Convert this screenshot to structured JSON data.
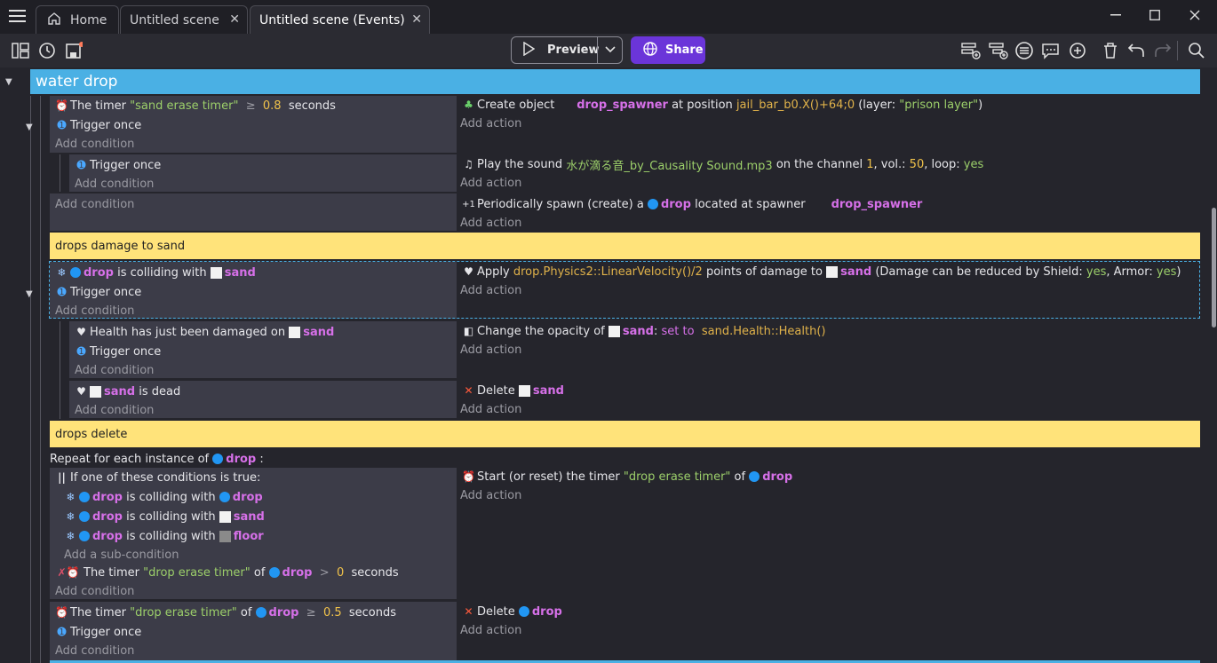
{
  "tabs": {
    "home": "Home",
    "scene": "Untitled scene",
    "events": "Untitled scene (Events)"
  },
  "toolbar": {
    "preview": "Preview",
    "share": "Share"
  },
  "group": {
    "title": "water drop"
  },
  "comments": [
    "drops damage to sand",
    "drops delete"
  ],
  "e1": {
    "c1": {
      "pre": "The timer",
      "str": "\"sand erase timer\"",
      "op": "≥",
      "num": "0.8",
      "post": "seconds"
    },
    "c2": "Trigger once",
    "a1": {
      "pre": "Create object",
      "obj": "drop_spawner",
      "mid": "at position",
      "expr": "jail_bar_b0.X()+64;0",
      "layer_pre": "(layer:",
      "layer": "\"prison layer\"",
      "layer_post": ")"
    }
  },
  "e1s": {
    "c1": "Trigger once",
    "a1": {
      "pre": "Play the sound",
      "file": "水が滴る音_by_Causality Sound.mp3",
      "mid": "on the channel",
      "chan": "1",
      "vol_pre": ", vol.:",
      "vol": "50",
      "loop_pre": ", loop:",
      "loop": "yes"
    }
  },
  "e2": {
    "a1": {
      "pre": "Periodically spawn (create) a",
      "obj": "drop",
      "mid": "located at spawner",
      "spawner": "drop_spawner"
    }
  },
  "e3": {
    "c1": {
      "obj": "drop",
      "mid": "is colliding with",
      "obj2": "sand"
    },
    "c2": "Trigger once",
    "a1": {
      "pre": "Apply",
      "expr": "drop.Physics2::LinearVelocity()/2",
      "mid": "points of damage to",
      "obj": "sand",
      "tail1": "(Damage can be reduced by Shield:",
      "shield": "yes",
      "tail2": ", Armor:",
      "armor": "yes",
      "tail3": ")"
    }
  },
  "e3s1": {
    "c1": {
      "pre": "Health has just been damaged on",
      "obj": "sand"
    },
    "c2": "Trigger once",
    "a1": {
      "pre": "Change the opacity of",
      "obj": "sand",
      "colon": ":",
      "op": "set to",
      "expr": "sand.Health::Health()"
    }
  },
  "e3s2": {
    "c1": {
      "obj": "sand",
      "post": "is dead"
    },
    "a1": {
      "pre": "Delete",
      "obj": "sand"
    }
  },
  "e4": {
    "repeat": {
      "pre": "Repeat for each instance of",
      "obj": "drop",
      "post": ":"
    },
    "or": "If one of these conditions is true:",
    "subs": [
      {
        "obj": "drop",
        "mid": "is colliding with",
        "obj2": "drop"
      },
      {
        "obj": "drop",
        "mid": "is colliding with",
        "obj2": "sand"
      },
      {
        "obj": "drop",
        "mid": "is colliding with",
        "obj2": "floor"
      }
    ],
    "add_sub": "Add a sub-condition",
    "c2": {
      "pre": "The timer",
      "str": "\"drop erase timer\"",
      "of": "of",
      "obj": "drop",
      "op": ">",
      "num": "0",
      "post": "seconds"
    },
    "a1": {
      "pre": "Start (or reset) the timer",
      "str": "\"drop erase timer\"",
      "of": "of",
      "obj": "drop"
    }
  },
  "e5": {
    "c1": {
      "pre": "The timer",
      "str": "\"drop erase timer\"",
      "of": "of",
      "obj": "drop",
      "op": "≥",
      "num": "0.5",
      "post": "seconds"
    },
    "c2": "Trigger once",
    "a1": {
      "pre": "Delete",
      "obj": "drop"
    }
  },
  "labels": {
    "add_condition": "Add condition",
    "add_action": "Add action"
  },
  "colors": {
    "group": "#4ab0e4",
    "comment": "#ffe37a",
    "object": "#d670e8",
    "string": "#9ccf6a",
    "number": "#f0c24a",
    "share": "#6b35d9"
  },
  "icons": [
    "menu-icon",
    "home-icon",
    "close-icon",
    "minimize-icon",
    "maximize-icon",
    "window-close-icon",
    "panels-icon",
    "history-icon",
    "save-icon",
    "play-icon",
    "chevron-down-icon",
    "globe-icon",
    "add-event-icon",
    "add-subevent-icon",
    "add-group-icon",
    "add-comment-icon",
    "add-other-icon",
    "delete-icon",
    "undo-icon",
    "redo-icon",
    "search-icon",
    "timer-icon",
    "trigger-once-icon",
    "create-object-icon",
    "sound-icon",
    "spawn-icon",
    "collision-icon",
    "health-icon",
    "opacity-icon",
    "delete-x-icon",
    "or-icon"
  ]
}
